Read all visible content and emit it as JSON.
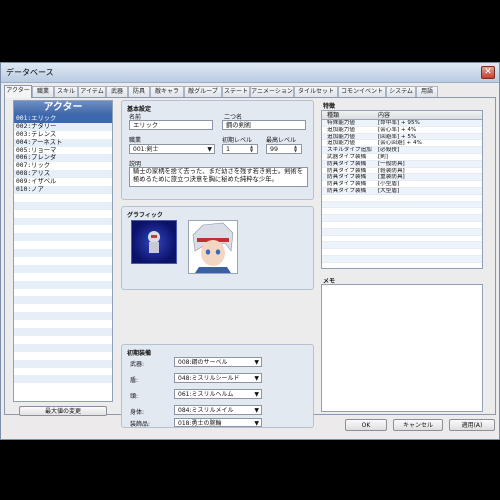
{
  "window": {
    "title": "データベース",
    "close": "✕"
  },
  "tabs": [
    "アクター",
    "職業",
    "スキル",
    "アイテム",
    "武器",
    "防具",
    "敵キャラ",
    "敵グループ",
    "ステート",
    "アニメーション",
    "タイルセット",
    "コモンイベント",
    "システム",
    "用語"
  ],
  "actor_list": {
    "header": "アクター",
    "items": [
      "001:エリック",
      "002:ナタリー",
      "003:テレンス",
      "004:アーネスト",
      "005:リョーマ",
      "006:ブレンダ",
      "007:リック",
      "008:アリス",
      "009:イザベル",
      "010:ノア"
    ],
    "max_button": "最大値の変更"
  },
  "basic": {
    "section": "基本設定",
    "name_label": "名前",
    "name": "エリック",
    "nickname_label": "二つ名",
    "nickname": "鋼の剣術",
    "class_label": "職業",
    "class": "001:剣士",
    "init_level_label": "初期レベル",
    "init_level": "1",
    "max_level_label": "最高レベル",
    "max_level": "99",
    "desc_label": "説明",
    "desc": "騎士の家柄を捨て去った、まだ幼さを残す若き剣士。剣術を極めるために旅立つ決意を胸に秘めた純粋な少年。"
  },
  "graphics": {
    "section": "グラフィック"
  },
  "equip": {
    "section": "初期装備",
    "rows": [
      {
        "label": "武器:",
        "value": "008:鋼のサーベル"
      },
      {
        "label": "盾:",
        "value": "048:ミスリルシールド"
      },
      {
        "label": "頭:",
        "value": "061:ミスリルヘルム"
      },
      {
        "label": "身体:",
        "value": "084:ミスリルメイル"
      },
      {
        "label": "装飾品:",
        "value": "018:勇士の腕輪"
      }
    ]
  },
  "traits": {
    "section": "特徴",
    "col1": "種類",
    "col2": "内容",
    "rows": [
      [
        "特殊能力値",
        "[命中率] + 95%"
      ],
      [
        "追加能力値",
        "[会心率] + 4%"
      ],
      [
        "追加能力値",
        "[回避率] + 5%"
      ],
      [
        "追加能力値",
        "[会心回避] + 4%"
      ],
      [
        "スキルタイプ追加",
        "[必殺技]"
      ],
      [
        "武器タイプ装備",
        "[剣]"
      ],
      [
        "防具タイプ装備",
        "[一般防具]"
      ],
      [
        "防具タイプ装備",
        "[軽装防具]"
      ],
      [
        "防具タイプ装備",
        "[重装防具]"
      ],
      [
        "防具タイプ装備",
        "[小型盾]"
      ],
      [
        "防具タイプ装備",
        "[大型盾]"
      ],
      [
        "",
        ""
      ],
      [
        "",
        ""
      ],
      [
        "",
        ""
      ],
      [
        "",
        ""
      ],
      [
        "",
        ""
      ],
      [
        "",
        ""
      ],
      [
        "",
        ""
      ],
      [
        "",
        ""
      ],
      [
        "",
        ""
      ],
      [
        "",
        ""
      ]
    ]
  },
  "memo": {
    "section": "メモ"
  },
  "buttons": {
    "ok": "OK",
    "cancel": "キャンセル",
    "apply": "適用(A)"
  }
}
